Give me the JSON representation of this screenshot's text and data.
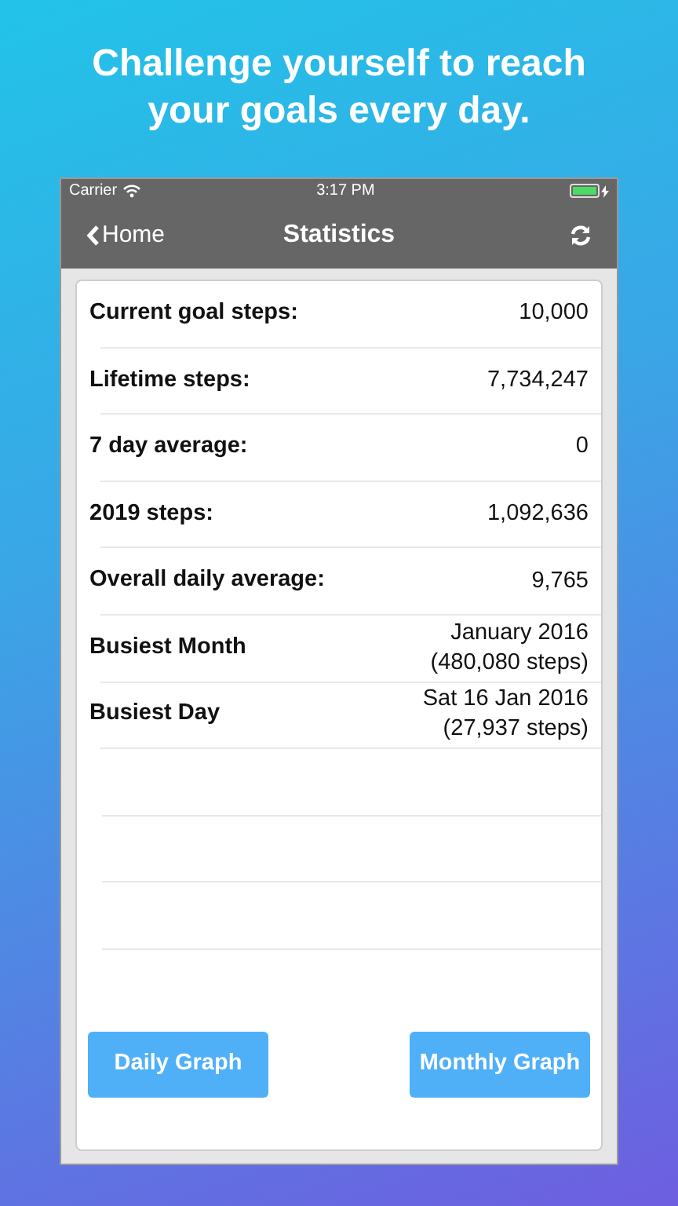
{
  "headline": "Challenge yourself to reach your goals every day.",
  "status_bar": {
    "carrier": "Carrier",
    "time": "3:17 PM"
  },
  "nav_bar": {
    "back": "Home",
    "title": "Statistics"
  },
  "stats": [
    {
      "label": "Current goal steps:",
      "value": [
        "10,000"
      ]
    },
    {
      "label": "Lifetime steps:",
      "value": [
        "7,734,247"
      ]
    },
    {
      "label": "7 day average:",
      "value": [
        "0"
      ]
    },
    {
      "label": "2019 steps:",
      "value": [
        "1,092,636"
      ]
    },
    {
      "label": "Overall daily average:",
      "value": [
        "9,765"
      ]
    },
    {
      "label": "Busiest Month",
      "value": [
        "January 2016",
        "(480,080 steps)"
      ]
    },
    {
      "label": "Busiest Day",
      "value": [
        "Sat 16 Jan 2016",
        "(27,937 steps)"
      ]
    }
  ],
  "buttons": [
    "Daily Graph",
    "Monthly Graph"
  ]
}
